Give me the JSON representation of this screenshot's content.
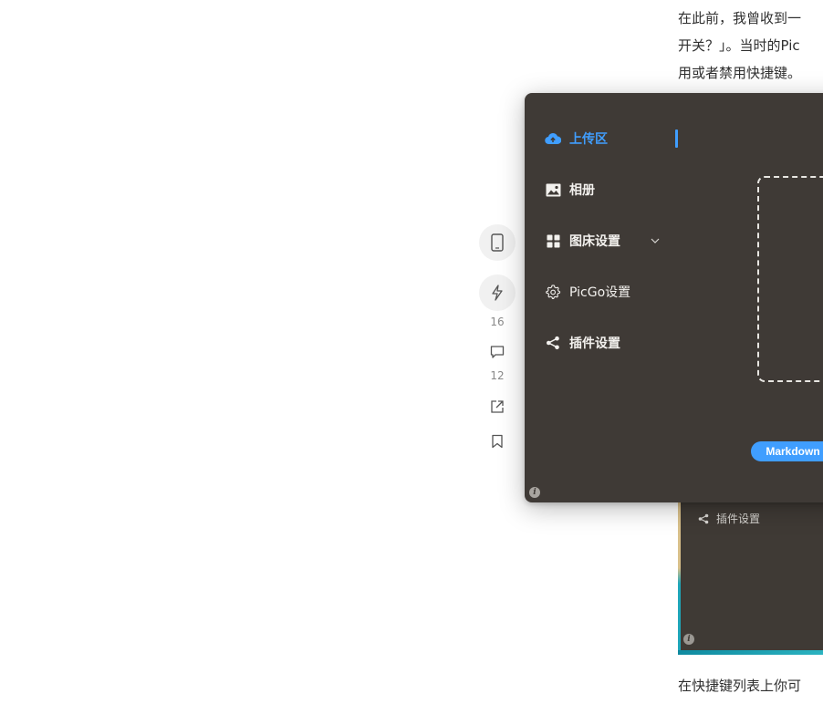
{
  "article": {
    "lines": [
      "在此前，我曾收到一",
      "开关？」。当时的Pic",
      "用或者禁用快捷键。"
    ],
    "bottom_line": "在快捷键列表上你可"
  },
  "actions": {
    "like_count": "16",
    "comment_count": "12"
  },
  "app": {
    "nav": [
      {
        "label": "上传区",
        "icon": "cloud-upload-icon",
        "active": true
      },
      {
        "label": "相册",
        "icon": "image-icon"
      },
      {
        "label": "图床设置",
        "icon": "grid-icon",
        "has_submenu": true
      },
      {
        "label": "PicGo设置",
        "icon": "gear-icon"
      },
      {
        "label": "插件设置",
        "icon": "share-icon"
      }
    ],
    "format_button": "Markdown",
    "info_glyph": "i"
  },
  "background_shot": {
    "item_label": "插件设置",
    "info_glyph": "i"
  },
  "colors": {
    "accent": "#409eff",
    "window_bg": "#3f3a36"
  }
}
